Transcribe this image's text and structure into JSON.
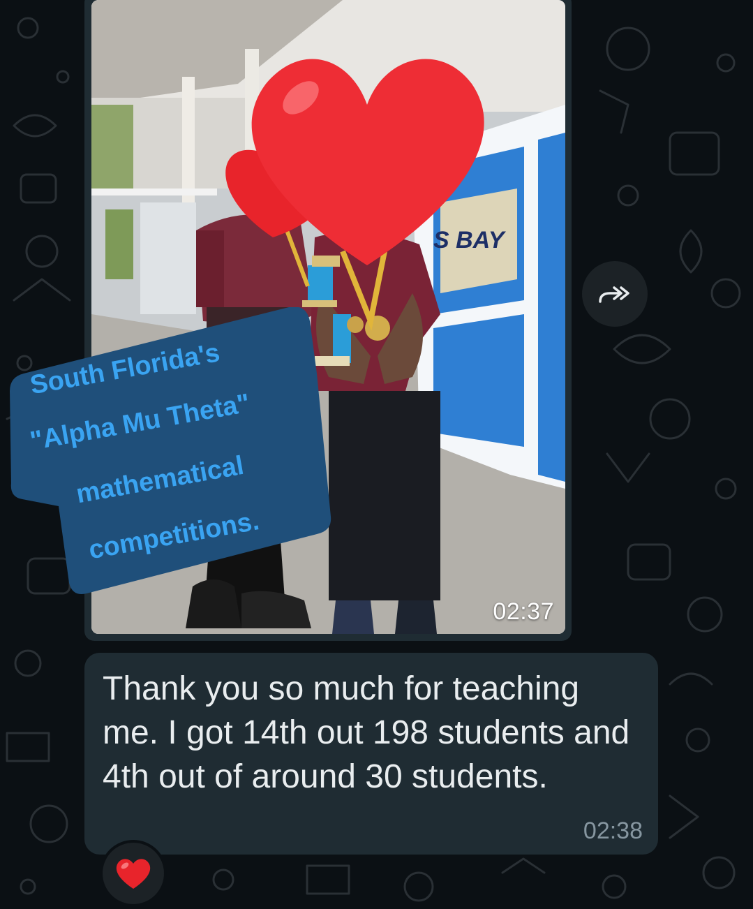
{
  "image_message": {
    "time": "02:37",
    "photo_alt": "Photo of two students in maroon shirts holding trophies and medals",
    "caption_lines": [
      "South Florida's",
      "\"Alpha Mu Theta\"",
      "mathematical",
      "competitions."
    ],
    "sign_text": "S BAY"
  },
  "forward": {
    "icon": "forward-double-arrow-icon"
  },
  "text_message": {
    "text": "Thank you so much for teaching me. I got 14th out 198 students and 4th out of around 30 students.",
    "time": "02:38"
  },
  "reaction": {
    "emoji": "heart",
    "icon": "red-heart-icon"
  },
  "colors": {
    "background": "#0b1014",
    "bubble": "#1f2c33",
    "caption_text": "#3aa4f2",
    "caption_bg": "#1f4f7a",
    "heart": "#e8242b"
  }
}
